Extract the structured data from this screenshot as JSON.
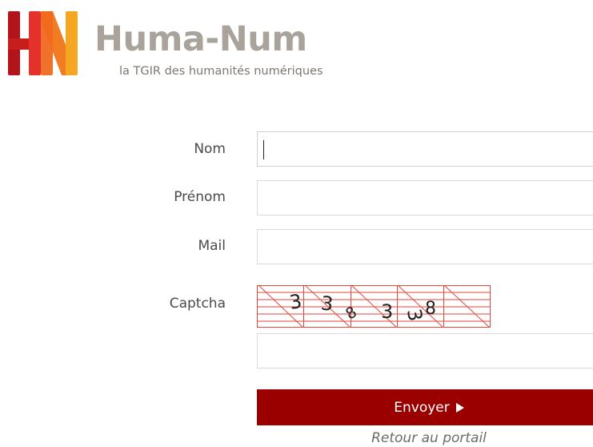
{
  "brand": {
    "logo_letters": "HN",
    "name": "Huma-Num",
    "tagline": "la TGIR des humanités numériques",
    "colors": {
      "dark_red": "#b3141c",
      "red": "#e4312b",
      "orange": "#f5a623",
      "wordmark_gray": "#a9a39b"
    }
  },
  "form": {
    "fields": [
      {
        "label": "Nom",
        "value": ""
      },
      {
        "label": "Prénom",
        "value": ""
      },
      {
        "label": "Mail",
        "value": ""
      }
    ],
    "captcha": {
      "label": "Captcha",
      "image_characters": [
        "3",
        "3",
        "8",
        "3",
        "3",
        "8"
      ],
      "value": ""
    },
    "submit_label": "Envoyer",
    "submit_icon": "play-icon",
    "submit_color": "#9b0000",
    "back_link": "Retour au portail"
  }
}
